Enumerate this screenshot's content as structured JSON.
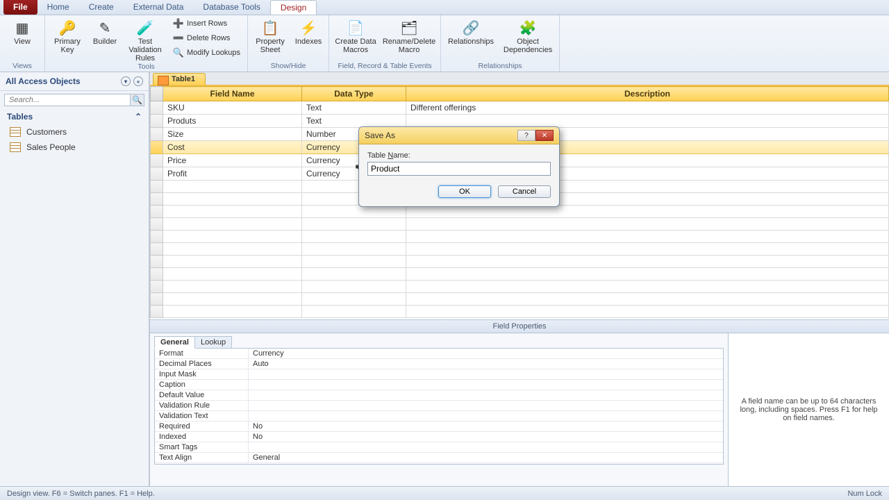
{
  "tabs": {
    "file": "File",
    "home": "Home",
    "create": "Create",
    "external": "External Data",
    "dbtools": "Database Tools",
    "design": "Design"
  },
  "ribbon": {
    "views": {
      "view": "View",
      "group": "Views"
    },
    "tools": {
      "primary": "Primary Key",
      "builder": "Builder",
      "test": "Test Validation Rules",
      "insert": "Insert Rows",
      "delete": "Delete Rows",
      "modify": "Modify Lookups",
      "group": "Tools"
    },
    "showhide": {
      "property": "Property Sheet",
      "indexes": "Indexes",
      "group": "Show/Hide"
    },
    "events": {
      "createdata": "Create Data Macros",
      "rename": "Rename/Delete Macro",
      "group": "Field, Record & Table Events"
    },
    "rel": {
      "relationships": "Relationships",
      "objdep": "Object Dependencies",
      "group": "Relationships"
    }
  },
  "nav": {
    "header": "All Access Objects",
    "search_placeholder": "Search...",
    "tables_label": "Tables",
    "items": [
      "Customers",
      "Sales People"
    ]
  },
  "doc": {
    "tab": "Table1"
  },
  "grid": {
    "h_field": "Field Name",
    "h_type": "Data Type",
    "h_desc": "Description",
    "rows": [
      {
        "f": "SKU",
        "t": "Text",
        "d": "Different offerings"
      },
      {
        "f": "Produts",
        "t": "Text",
        "d": ""
      },
      {
        "f": "Size",
        "t": "Number",
        "d": ""
      },
      {
        "f": "Cost",
        "t": "Currency",
        "d": ""
      },
      {
        "f": "Price",
        "t": "Currency",
        "d": ""
      },
      {
        "f": "Profit",
        "t": "Currency",
        "d": ""
      }
    ]
  },
  "fp": {
    "header": "Field Properties",
    "tab_general": "General",
    "tab_lookup": "Lookup",
    "rows": [
      {
        "k": "Format",
        "v": "Currency"
      },
      {
        "k": "Decimal Places",
        "v": "Auto"
      },
      {
        "k": "Input Mask",
        "v": ""
      },
      {
        "k": "Caption",
        "v": ""
      },
      {
        "k": "Default Value",
        "v": ""
      },
      {
        "k": "Validation Rule",
        "v": ""
      },
      {
        "k": "Validation Text",
        "v": ""
      },
      {
        "k": "Required",
        "v": "No"
      },
      {
        "k": "Indexed",
        "v": "No"
      },
      {
        "k": "Smart Tags",
        "v": ""
      },
      {
        "k": "Text Align",
        "v": "General"
      }
    ],
    "help": "A field name can be up to 64 characters long, including spaces. Press F1 for help on field names."
  },
  "dialog": {
    "title": "Save As",
    "table_name_label": "Table Name:",
    "value": "Product",
    "ok": "OK",
    "cancel": "Cancel"
  },
  "status": {
    "left": "Design view.   F6 = Switch panes.   F1 = Help.",
    "right": "Num Lock"
  }
}
